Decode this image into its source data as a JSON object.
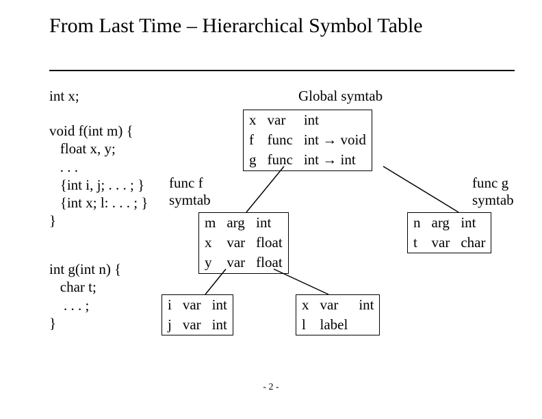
{
  "title": "From Last Time – Hierarchical Symbol Table",
  "code": {
    "decl": "int x;",
    "func_f": "void f(int m) {\n   float x, y;\n   . . .\n   {int i, j; . . . ; }\n   {int x; l: . . . ; }\n}",
    "func_g": "int g(int n) {\n   char t;\n    . . . ;\n}"
  },
  "labels": {
    "global": "Global symtab",
    "funcf": "func f\nsymtab",
    "funcg": "func g\nsymtab"
  },
  "arrow": "→",
  "tables": {
    "global": [
      {
        "name": "x",
        "kind": "var",
        "type": "int"
      },
      {
        "name": "f",
        "kind": "func",
        "type": "int → void"
      },
      {
        "name": "g",
        "kind": "func",
        "type": "int → int"
      }
    ],
    "funcf": [
      {
        "name": "m",
        "kind": "arg",
        "type": "int"
      },
      {
        "name": "x",
        "kind": "var",
        "type": "float"
      },
      {
        "name": "y",
        "kind": "var",
        "type": "float"
      }
    ],
    "funcg": [
      {
        "name": "n",
        "kind": "arg",
        "type": "int"
      },
      {
        "name": "t",
        "kind": "var",
        "type": "char"
      }
    ],
    "block_ij": [
      {
        "name": "i",
        "kind": "var",
        "type": "int"
      },
      {
        "name": "j",
        "kind": "var",
        "type": "int"
      }
    ],
    "block_xl": [
      {
        "name": "x",
        "kind": "var",
        "type": "int"
      },
      {
        "name": "l",
        "kind": "label",
        "type": ""
      }
    ]
  },
  "footer": "- 2 -"
}
